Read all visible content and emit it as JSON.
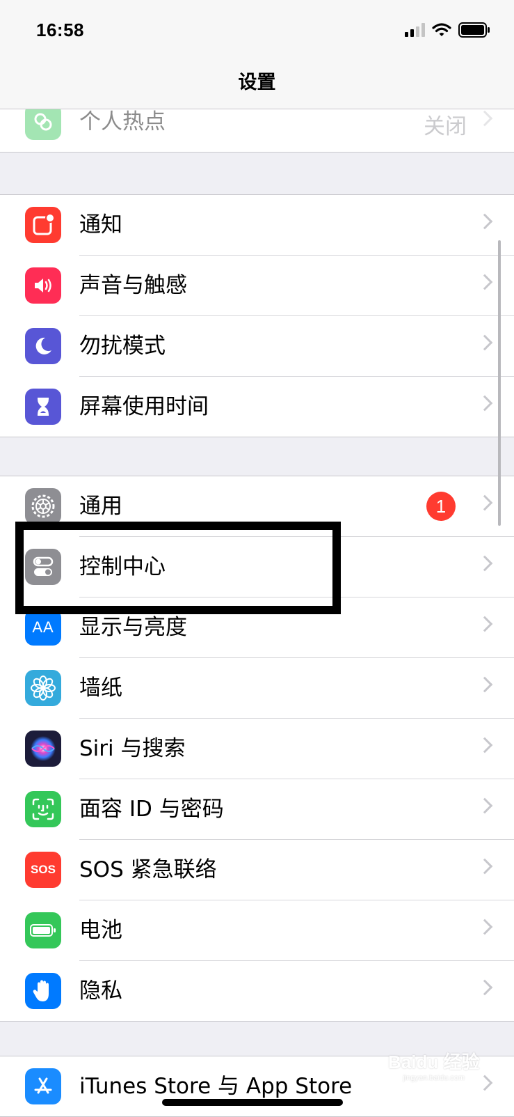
{
  "status_bar": {
    "time": "16:58"
  },
  "nav": {
    "title": "设置"
  },
  "rows": {
    "hotspot": {
      "label": "个人热点",
      "value": "关闭"
    },
    "notifications": {
      "label": "通知"
    },
    "sounds": {
      "label": "声音与触感"
    },
    "dnd": {
      "label": "勿扰模式"
    },
    "screen_time": {
      "label": "屏幕使用时间"
    },
    "general": {
      "label": "通用",
      "badge": "1"
    },
    "control_center": {
      "label": "控制中心"
    },
    "display": {
      "label": "显示与亮度"
    },
    "wallpaper": {
      "label": "墙纸"
    },
    "siri": {
      "label": "Siri 与搜索"
    },
    "face_id": {
      "label": "面容 ID 与密码"
    },
    "sos": {
      "label": "SOS 紧急联络"
    },
    "battery": {
      "label": "电池"
    },
    "privacy": {
      "label": "隐私"
    },
    "itunes": {
      "label": "iTunes Store 与 App Store"
    }
  },
  "icons": {
    "hotspot": {
      "name": "hotspot-icon",
      "color": "#34c759"
    },
    "notifications": {
      "name": "notifications-icon",
      "color": "#ff3b30"
    },
    "sounds": {
      "name": "speaker-icon",
      "color": "#ff2d55"
    },
    "dnd": {
      "name": "moon-icon",
      "color": "#5856d6"
    },
    "screen_time": {
      "name": "hourglass-icon",
      "color": "#5856d6"
    },
    "general": {
      "name": "gear-icon",
      "color": "#8e8e93"
    },
    "control_center": {
      "name": "toggles-icon",
      "color": "#8e8e93"
    },
    "display": {
      "name": "text-size-icon",
      "color": "#007aff"
    },
    "wallpaper": {
      "name": "flower-icon",
      "color": "#34aadc"
    },
    "siri": {
      "name": "siri-icon",
      "color": "#1c1c3a"
    },
    "face_id": {
      "name": "face-id-icon",
      "color": "#34c759"
    },
    "sos": {
      "name": "sos-icon",
      "color": "#ff3b30",
      "text": "SOS"
    },
    "battery": {
      "name": "battery-icon",
      "color": "#34c759"
    },
    "privacy": {
      "name": "hand-icon",
      "color": "#007aff"
    },
    "itunes": {
      "name": "app-store-icon",
      "color": "#1a8cff"
    }
  },
  "display_icon_text": "AA",
  "watermark": {
    "main": "Baidu 经验",
    "sub": "jingyan.baidu.com"
  }
}
